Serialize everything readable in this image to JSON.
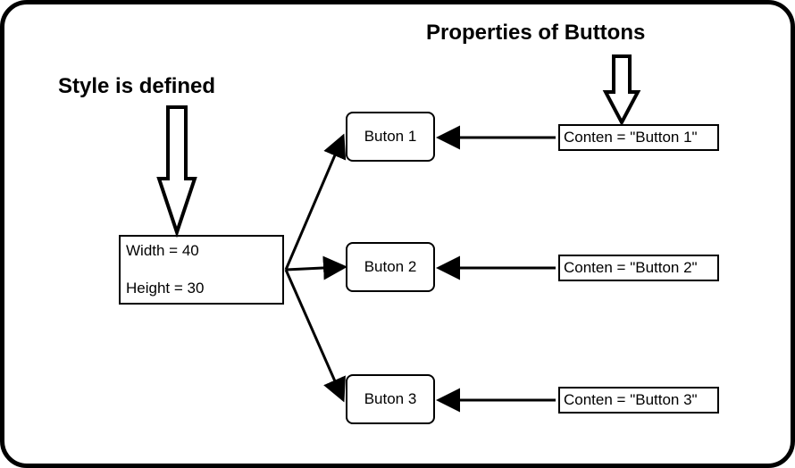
{
  "title_style": "Style is defined",
  "title_props": "Properties of Buttons",
  "style": {
    "width_line": "Width = 40",
    "height_line": "Height = 30"
  },
  "buttons": [
    {
      "label": "Buton 1",
      "content": "Conten = \"Button 1\""
    },
    {
      "label": "Buton 2",
      "content": "Conten = \"Button 2\""
    },
    {
      "label": "Buton 3",
      "content": "Conten = \"Button 3\""
    }
  ]
}
